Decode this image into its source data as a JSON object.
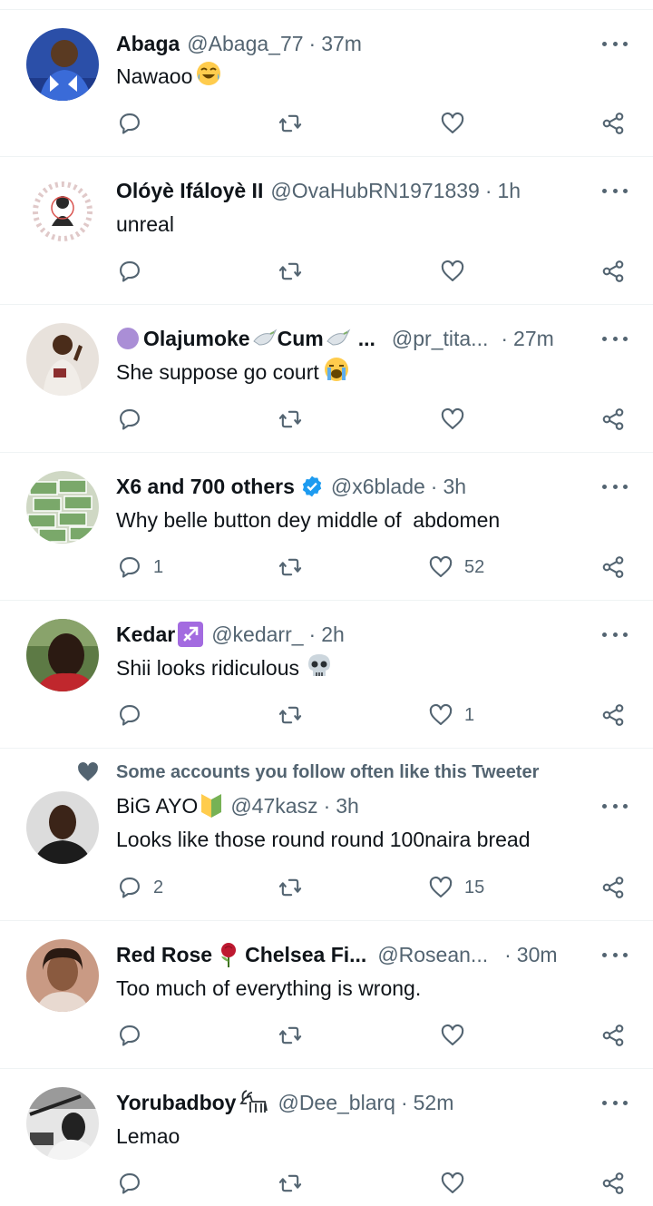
{
  "tweets": [
    {
      "name": "Abaga",
      "handle": "@Abaga_77",
      "separator": "·",
      "time": "37m",
      "text": "Nawaoo",
      "text_emoji": "joy-emoji",
      "avatar_icon": "avatar-man-blue-shirt",
      "replies": "",
      "likes": ""
    },
    {
      "name": "Olóyè Ifáloyè II",
      "handle": "@OvaHubRN1971839",
      "separator": "·",
      "time": "1h",
      "text": "unreal",
      "avatar_icon": "avatar-ifa-circle",
      "replies": "",
      "likes": ""
    },
    {
      "name_prefix_icon": "purple-circle-emoji",
      "name": "Olajumoke",
      "name_mid": "Cum",
      "name_suffix": "...",
      "name_icons": [
        "dove-emoji",
        "dove-emoji"
      ],
      "handle": "@pr_tita...",
      "separator": "·",
      "time": "27m",
      "text": "She suppose go court",
      "text_emoji": "crying-emoji",
      "avatar_icon": "avatar-woman-book",
      "replies": "",
      "likes": ""
    },
    {
      "name": "X6 and 700 others",
      "verified": true,
      "handle": "@x6blade",
      "separator": "·",
      "time": "3h",
      "text": "Why belle button dey middle of  abdomen",
      "avatar_icon": "avatar-money-stacks",
      "replies": "1",
      "likes": "52"
    },
    {
      "name": "Kedar",
      "name_icon": "sagittarius-emoji",
      "handle": "@kedarr_",
      "separator": "·",
      "time": "2h",
      "text": "Shii looks ridiculous",
      "text_emoji": "skull-emoji",
      "avatar_icon": "avatar-man-selfie",
      "replies": "",
      "likes": "1"
    },
    {
      "social_context": "Some accounts you follow often like this Tweeter",
      "name": "BiG AYO",
      "name_icon": "beginner-emoji",
      "handle": "@47kasz",
      "separator": "·",
      "time": "3h",
      "text": "Looks like those round round 100naira bread",
      "avatar_icon": "avatar-man-dark",
      "replies": "2",
      "likes": "15"
    },
    {
      "name": "Red Rose",
      "name_icon": "rose-emoji",
      "name_rest": "Chelsea Fi...",
      "handle": "@Rosean...",
      "separator": "·",
      "time": "30m",
      "text": "Too much of everything is wrong.",
      "avatar_icon": "avatar-woman-portrait",
      "replies": "",
      "likes": ""
    },
    {
      "name": "Yorubadboy",
      "name_icon": "goat-emoji",
      "handle": "@Dee_blarq",
      "separator": "·",
      "time": "52m",
      "text": "Lemao",
      "avatar_icon": "avatar-bw-photo",
      "replies": "",
      "likes": ""
    }
  ],
  "colors": {
    "text": "#0f1419",
    "secondary": "#536471",
    "divider": "#eff3f4",
    "verified": "#1d9bf0"
  }
}
